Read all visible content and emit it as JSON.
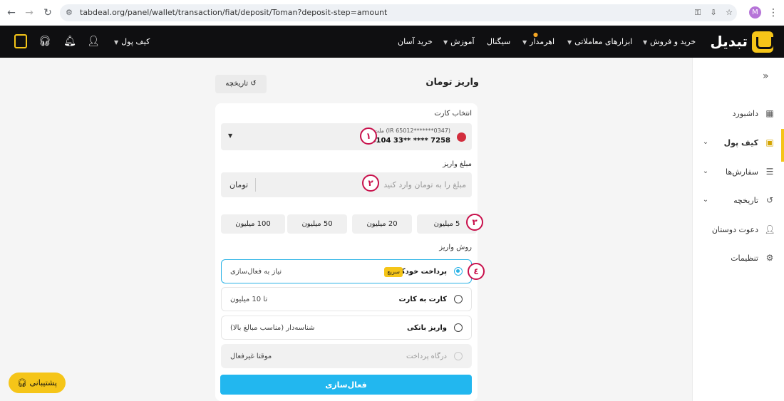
{
  "browser": {
    "url": "tabdeal.org/panel/wallet/transaction/fiat/deposit/Toman?deposit-step=amount",
    "profile_initial": "M"
  },
  "header": {
    "logo_text": "تبدیل",
    "nav": [
      {
        "label": "خرید و فروش"
      },
      {
        "label": "ابزارهای معاملاتی"
      },
      {
        "label": "اهرمدار"
      },
      {
        "label": "سیگنال"
      },
      {
        "label": "آموزش"
      },
      {
        "label": "خرید آسان"
      }
    ],
    "wallet_label": "کیف پول"
  },
  "sidebar": {
    "items": [
      {
        "label": "داشبورد",
        "icon": "grid-icon"
      },
      {
        "label": "کیف پول",
        "icon": "wallet-icon"
      },
      {
        "label": "سفارش‌ها",
        "icon": "orders-icon"
      },
      {
        "label": "تاریخچه",
        "icon": "history-icon"
      },
      {
        "label": "دعوت دوستان",
        "icon": "add-user-icon"
      },
      {
        "label": "تنظیمات",
        "icon": "gear-icon"
      }
    ]
  },
  "main": {
    "title": "واریز تومان",
    "history_button": "تاریخچه",
    "select_card_label": "انتخاب کارت",
    "card": {
      "line1": "ملت (IR 65012*******0347)",
      "line2": "6104 33** **** 7258"
    },
    "amount_label": "مبلغ واریز",
    "amount_placeholder": "مبلغ را به تومان وارد کنید",
    "amount_unit": "تومان",
    "quick_amounts": [
      "5 میلیون",
      "20 میلیون",
      "50 میلیون",
      "100 میلیون"
    ],
    "method_label": "روش واریز",
    "methods": [
      {
        "name": "پرداخت خودکار",
        "badge": "سریع",
        "note": "نیاز به فعال‌سازی"
      },
      {
        "name": "کارت به کارت",
        "note": "تا 10 میلیون"
      },
      {
        "name": "واریز بانکی",
        "note": "شناسه‌دار (مناسب مبالغ بالا)"
      },
      {
        "name": "درگاه پرداخت",
        "note": "موقتا غیرفعال"
      }
    ],
    "submit_label": "فعال‌سازی"
  },
  "steps": [
    "١",
    "٢",
    "٣",
    "٤"
  ],
  "support_label": "پشتیبانی",
  "colors": {
    "accent": "#f5c518",
    "primary": "#22b7ef",
    "step_marker": "#c8104b",
    "header_bg": "#0f0f11"
  }
}
